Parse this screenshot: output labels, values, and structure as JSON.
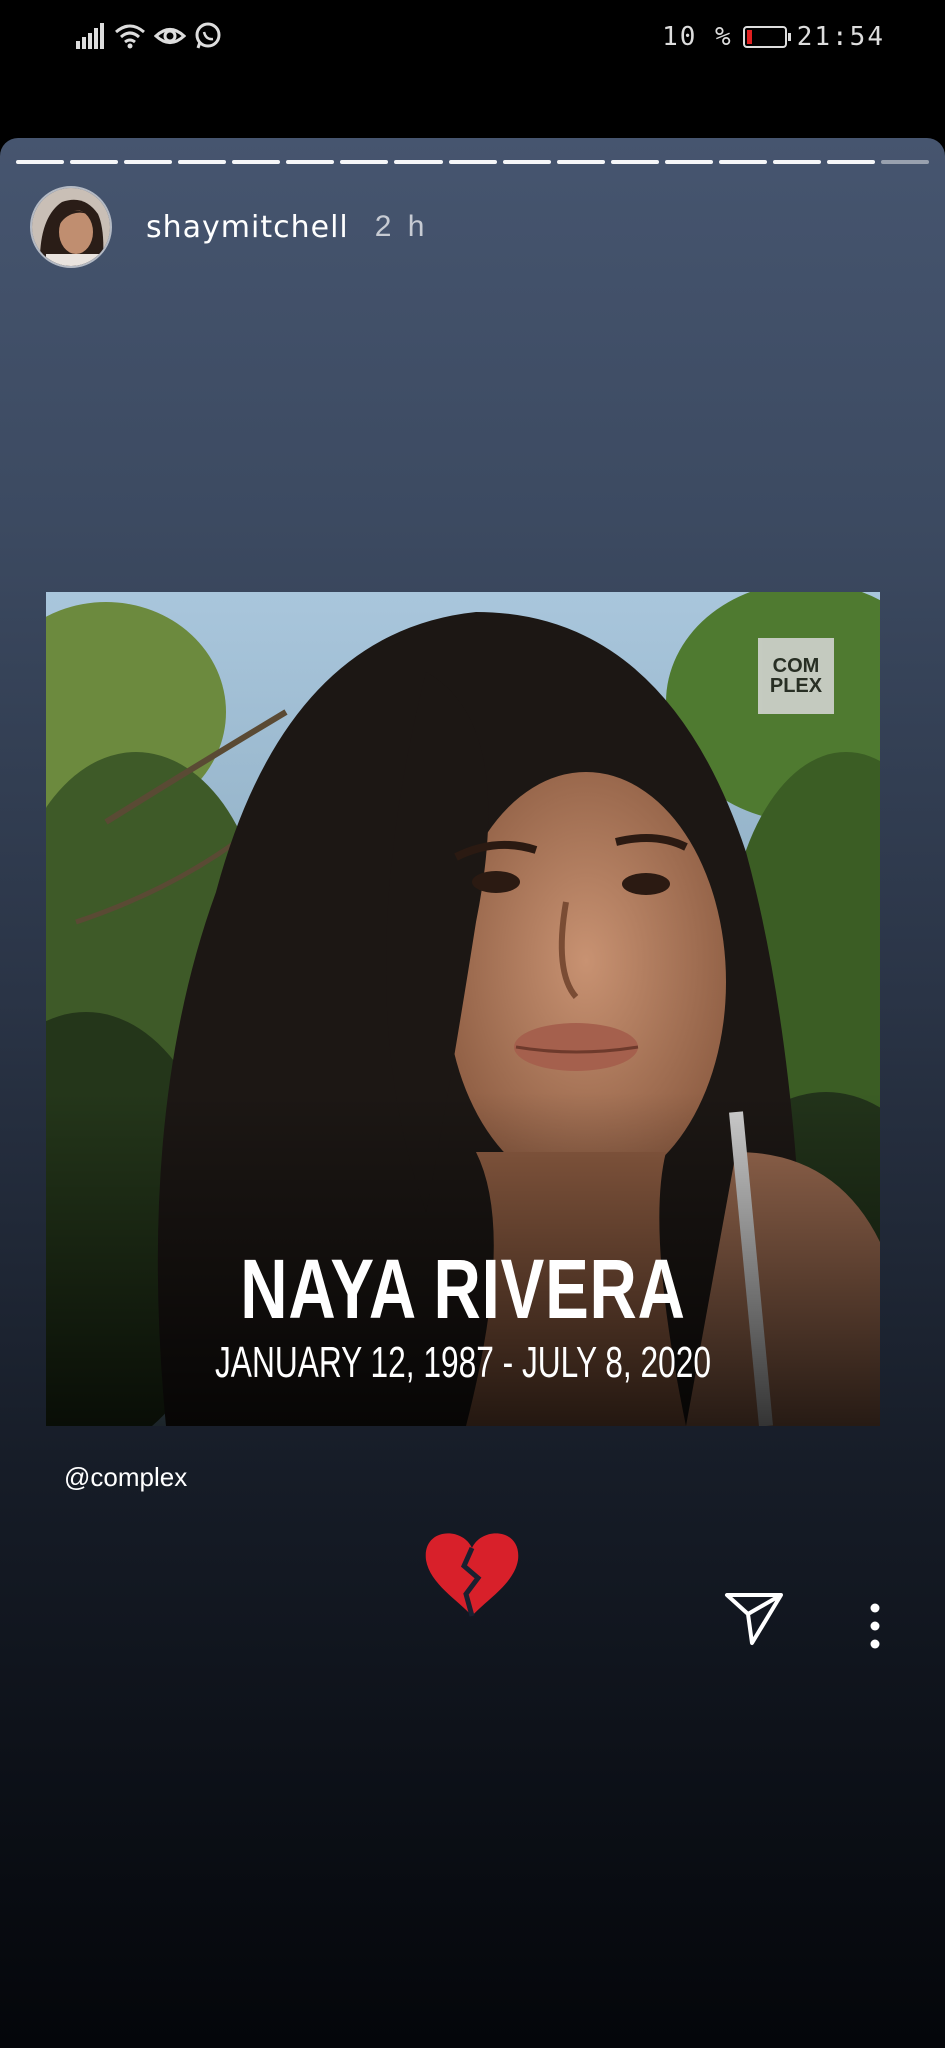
{
  "status_bar": {
    "battery_percent": "10 %",
    "time": "21:54",
    "icons": [
      "signal-icon",
      "wifi-icon",
      "eye-icon",
      "whatsapp-icon",
      "battery-icon"
    ]
  },
  "story": {
    "progress_segments": 17,
    "user": {
      "username": "shaymitchell",
      "time_ago": "2 h"
    },
    "post": {
      "logo_text": "COM PLEX",
      "name": "NAYA RIVERA",
      "dates": "JANUARY 12, 1987 - JULY 8, 2020"
    },
    "mention": "@complex",
    "emoji": "broken-heart-icon"
  },
  "colors": {
    "background_top": "#46556f",
    "background_bottom": "#04060a",
    "heart": "#d8202a"
  }
}
